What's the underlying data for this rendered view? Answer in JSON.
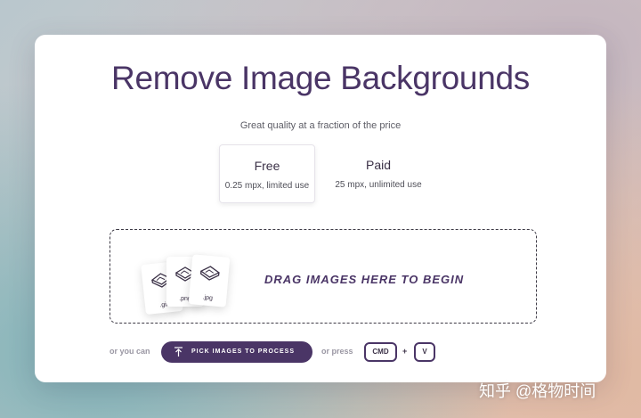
{
  "header": {
    "title": "Remove Image Backgrounds",
    "subtitle": "Great quality at a fraction of the price"
  },
  "plans": [
    {
      "name": "Free",
      "description": "0.25 mpx, limited use",
      "selected": true
    },
    {
      "name": "Paid",
      "description": "25 mpx, unlimited use",
      "selected": false
    }
  ],
  "dropzone": {
    "label": "DRAG IMAGES HERE TO BEGIN",
    "file_types": [
      ".gif",
      ".png",
      ".jpg"
    ]
  },
  "actions": {
    "or_you_can": "or you can",
    "pick_button": "PICK IMAGES TO PROCESS",
    "or_press": "or press",
    "key_cmd": "CMD",
    "plus": "+",
    "key_v": "V"
  },
  "watermark": "知乎 @格物时间",
  "colors": {
    "accent": "#4a3566",
    "card": "#ffffff"
  }
}
